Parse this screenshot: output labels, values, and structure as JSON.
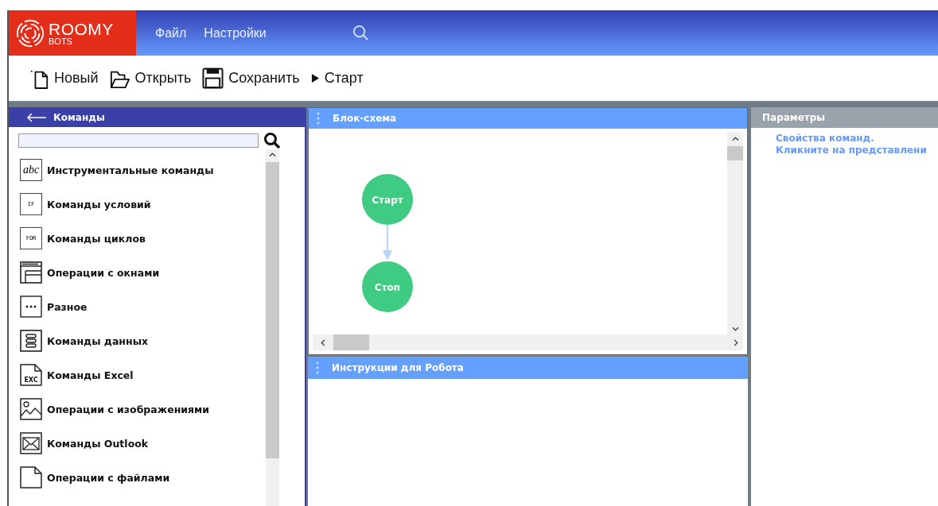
{
  "logo": {
    "name": "ROOMY",
    "sub": "BOTS"
  },
  "menu": [
    {
      "label": "Файл"
    },
    {
      "label": "Настройки"
    }
  ],
  "toolbar": [
    {
      "kind": "new",
      "label": "Новый"
    },
    {
      "kind": "open",
      "label": "Открыть"
    },
    {
      "kind": "save",
      "label": "Сохранить"
    },
    {
      "kind": "run",
      "label": "Старт"
    }
  ],
  "commands_panel": {
    "title": "Команды",
    "items": [
      {
        "kind": "text",
        "label": "Инструментальные команды",
        "icon_label": "abc"
      },
      {
        "kind": "tagged",
        "label": "Команды условий",
        "icon_label": "IF"
      },
      {
        "kind": "tagged",
        "label": "Команды циклов",
        "icon_label": "FOR"
      },
      {
        "kind": "window",
        "label": "Операции с окнами"
      },
      {
        "kind": "dots",
        "label": "Разное"
      },
      {
        "kind": "data",
        "label": "Команды данных"
      },
      {
        "kind": "file",
        "label": "Команды Excel",
        "icon_label": "EXC"
      },
      {
        "kind": "image",
        "label": "Операции с изображениями"
      },
      {
        "kind": "mail",
        "label": "Команды Outlook"
      },
      {
        "kind": "file",
        "label": "Операции с файлами"
      }
    ]
  },
  "flowchart_panel": {
    "title": "Блок-схема",
    "nodes": [
      {
        "label": "Старт"
      },
      {
        "label": "Стоп"
      }
    ]
  },
  "parameters_panel": {
    "title": "Параметры",
    "lines": [
      "Свойства команд.",
      "Кликните на представлени"
    ]
  },
  "instructions_panel": {
    "title": "Инструкции для Робота"
  }
}
